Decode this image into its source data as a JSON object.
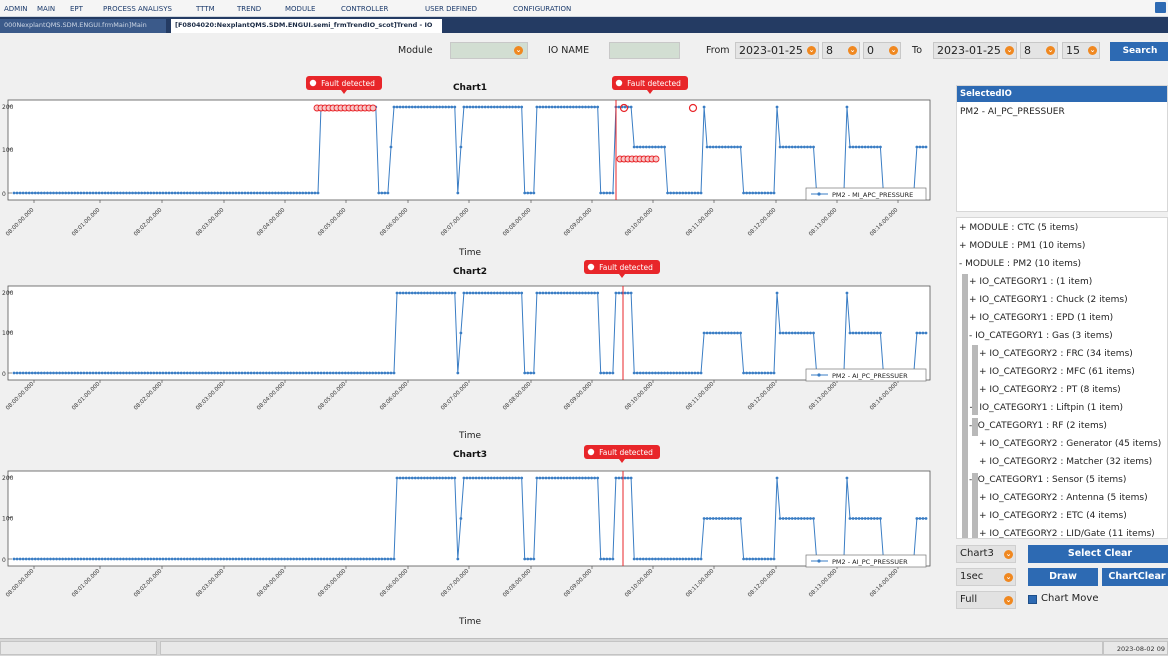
{
  "menu": {
    "items": [
      "ADMIN",
      "MAIN",
      "EPT",
      "PROCESS ANALISYS",
      "TTTM",
      "TREND",
      "MODULE",
      "CONTROLLER",
      "USER DEFINED",
      "CONFIGURATION"
    ]
  },
  "tabs": [
    {
      "label": "000NexplantQMS.SDM.ENGUI.frmMain]Main"
    },
    {
      "label": "[F0804020:NexplantQMS.SDM.ENGUI.semi_frmTrendIO_scot]Trend - IO"
    }
  ],
  "filter": {
    "module_label": "Module",
    "module_value": "",
    "ioname_label": "IO NAME",
    "ioname_value": "",
    "from_label": "From",
    "from_date": "2023-01-25",
    "from_hour": "8",
    "from_min": "0",
    "to_label": "To",
    "to_date": "2023-01-25",
    "to_hour": "8",
    "to_min": "15",
    "search_label": "Search"
  },
  "charts": [
    {
      "title": "Chart1",
      "legend": "PM2 - MI_APC_PRESSURE",
      "xlabel": "Time",
      "faults": [
        {
          "label": "Fault detected"
        },
        {
          "label": "Fault detected"
        }
      ]
    },
    {
      "title": "Chart2",
      "legend": "PM2 - AI_PC_PRESSUER",
      "xlabel": "Time",
      "faults": [
        {
          "label": "Fault detected"
        }
      ]
    },
    {
      "title": "Chart3",
      "legend": "PM2 - AI_PC_PRESSUER",
      "xlabel": "Time",
      "faults": [
        {
          "label": "Fault detected"
        }
      ]
    }
  ],
  "chart_data": [
    {
      "type": "line",
      "title": "Chart1",
      "xlabel": "Time",
      "x_ticks": [
        "08:00:00.000",
        "08:01:00.000",
        "08:02:00.000",
        "08:03:00.000",
        "08:04:00.000",
        "08:05:00.000",
        "08:06:00.000",
        "08:07:00.000",
        "08:08:00.000",
        "08:09:00.000",
        "08:10:00.000",
        "08:11:00.000",
        "08:12:00.000",
        "08:13:00.000",
        "08:14:00.000"
      ],
      "y_ticks": [
        "0",
        "100",
        "200"
      ],
      "series": [
        {
          "name": "PM2 - MI_APC_PRESSURE"
        }
      ]
    },
    {
      "type": "line",
      "title": "Chart2",
      "xlabel": "Time",
      "x_ticks": [
        "08:00:00.000",
        "08:01:00.000",
        "08:02:00.000",
        "08:03:00.000",
        "08:04:00.000",
        "08:05:00.000",
        "08:06:00.000",
        "08:07:00.000",
        "08:08:00.000",
        "08:09:00.000",
        "08:10:00.000",
        "08:11:00.000",
        "08:12:00.000",
        "08:13:00.000",
        "08:14:00.000"
      ],
      "y_ticks": [
        "0",
        "100",
        "200"
      ],
      "series": [
        {
          "name": "PM2 - AI_PC_PRESSUER"
        }
      ]
    },
    {
      "type": "line",
      "title": "Chart3",
      "xlabel": "Time",
      "x_ticks": [
        "08:00:00.000",
        "08:01:00.000",
        "08:02:00.000",
        "08:03:00.000",
        "08:04:00.000",
        "08:05:00.000",
        "08:06:00.000",
        "08:07:00.000",
        "08:08:00.000",
        "08:09:00.000",
        "08:10:00.000",
        "08:11:00.000",
        "08:12:00.000",
        "08:13:00.000",
        "08:14:00.000"
      ],
      "y_ticks": [
        "0",
        "100",
        "200"
      ],
      "series": [
        {
          "name": "PM2 - AI_PC_PRESSUER"
        }
      ]
    }
  ],
  "selected_io": {
    "header": "SelectedIO",
    "item": "PM2 - AI_PC_PRESSUER"
  },
  "tree": [
    {
      "label": "+ MODULE : CTC (5 items)"
    },
    {
      "label": "+ MODULE : PM1 (10 items)"
    },
    {
      "label": "- MODULE : PM2 (10 items)"
    },
    {
      "label": "+ IO_CATEGORY1 :  (1 item)"
    },
    {
      "label": "+ IO_CATEGORY1 : Chuck (2 items)"
    },
    {
      "label": "+ IO_CATEGORY1 : EPD (1 item)"
    },
    {
      "label": "- IO_CATEGORY1 : Gas (3 items)"
    },
    {
      "label": "+ IO_CATEGORY2 : FRC (34 items)"
    },
    {
      "label": "+ IO_CATEGORY2 : MFC (61 items)"
    },
    {
      "label": "+ IO_CATEGORY2 : PT (8 items)"
    },
    {
      "label": "+ IO_CATEGORY1 : Liftpin (1 item)"
    },
    {
      "label": "- IO_CATEGORY1 : RF (2 items)"
    },
    {
      "label": "+ IO_CATEGORY2 : Generator (45 items)"
    },
    {
      "label": "+ IO_CATEGORY2 : Matcher (32 items)"
    },
    {
      "label": "- IO_CATEGORY1 : Sensor (5 items)"
    },
    {
      "label": "+ IO_CATEGORY2 : Antenna (5 items)"
    },
    {
      "label": "+ IO_CATEGORY2 : ETC (4 items)"
    },
    {
      "label": "+ IO_CATEGORY2 : LID/Gate (11 items)"
    }
  ],
  "controls": {
    "chart_select": "Chart3",
    "interval_select": "1sec",
    "range_select": "Full",
    "select_clear": "Select Clear",
    "draw": "Draw",
    "chart_clear": "ChartClear",
    "chart_move": "Chart Move"
  },
  "status": {
    "datetime": "2023-08-02 09"
  },
  "colors": {
    "accent": "#2d6ab3",
    "series": "#3a7dc4",
    "fault": "#e8262a",
    "tab_bar": "#243b63"
  }
}
